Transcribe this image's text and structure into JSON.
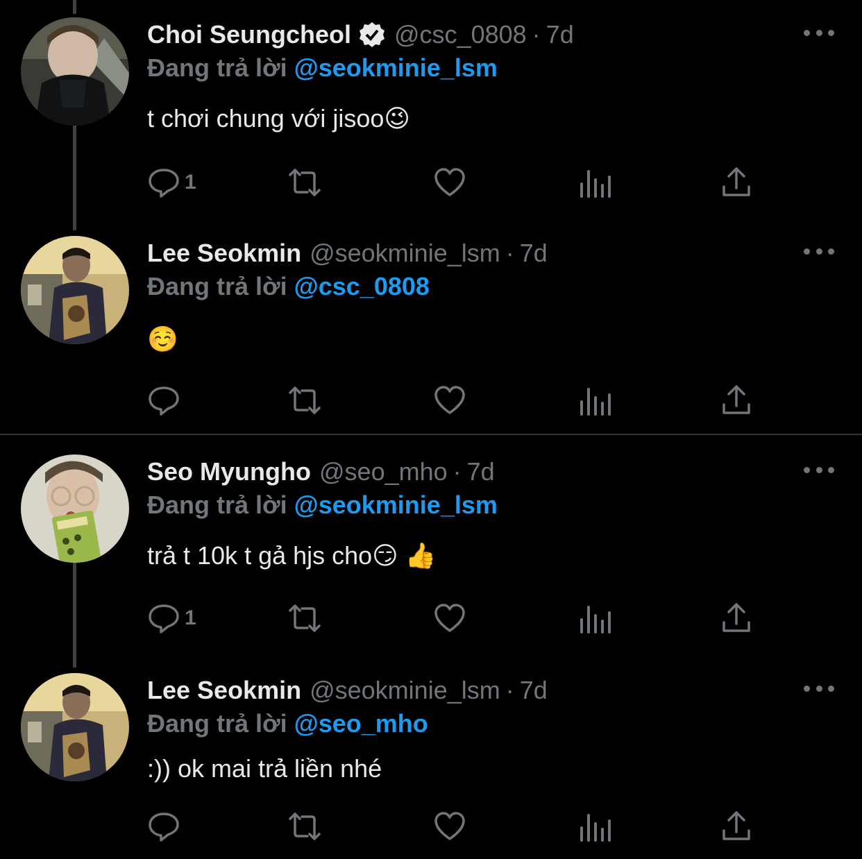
{
  "reply_prefix": "Đang trả lời",
  "tweets": [
    {
      "name": "Choi Seungcheol",
      "verified": true,
      "handle": "@csc_0808",
      "separator": "·",
      "time": "7d",
      "reply_to": "@seokminie_lsm",
      "text": "t chơi chung với jisoo😉",
      "reply_count": "1"
    },
    {
      "name": "Lee Seokmin",
      "verified": false,
      "handle": "@seokminie_lsm",
      "separator": "·",
      "time": "7d",
      "reply_to": "@csc_0808",
      "text": "☺️",
      "reply_count": ""
    },
    {
      "name": "Seo Myungho",
      "verified": false,
      "handle": "@seo_mho",
      "separator": "·",
      "time": "7d",
      "reply_to": "@seokminie_lsm",
      "text": "trả t 10k t gả hjs cho😏 👍",
      "reply_count": "1"
    },
    {
      "name": "Lee Seokmin",
      "verified": false,
      "handle": "@seokminie_lsm",
      "separator": "·",
      "time": "7d",
      "reply_to": "@seo_mho",
      "text": ":)) ok mai trả liền nhé",
      "reply_count": ""
    }
  ],
  "icons": {
    "reply": "reply-icon",
    "retweet": "retweet-icon",
    "like": "heart-icon",
    "views": "views-icon",
    "share": "share-icon",
    "more": "more-icon",
    "verified": "verified-badge-icon"
  },
  "colors": {
    "background": "#000000",
    "text": "#e7e9ea",
    "muted": "#71767b",
    "link": "#1d9bf0",
    "thread_line": "#3d4144",
    "divider": "#2f3336"
  }
}
